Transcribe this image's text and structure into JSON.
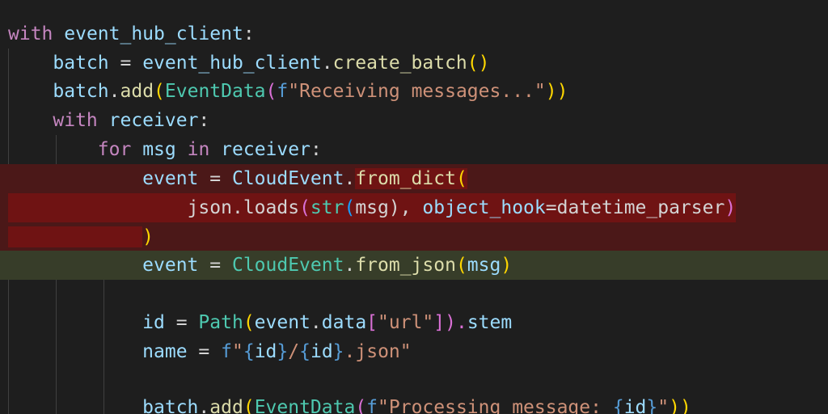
{
  "editor": {
    "lines": [
      {
        "segments": [
          "with",
          " ",
          "event_hub_client",
          ":"
        ]
      },
      {
        "segments": [
          "    ",
          "batch",
          " = ",
          "event_hub_client",
          ".",
          "create_batch",
          "()"
        ]
      },
      {
        "segments": [
          "    ",
          "batch",
          ".",
          "add",
          "(",
          "EventData",
          "(",
          "f",
          "\"Receiving messages...\"",
          "))"
        ]
      },
      {
        "segments": [
          "    ",
          "with",
          " ",
          "receiver",
          ":"
        ]
      },
      {
        "segments": [
          "        ",
          "for",
          " ",
          "msg",
          " ",
          "in",
          " ",
          "receiver",
          ":"
        ]
      },
      {
        "segments": [
          "            ",
          "event",
          " = ",
          "CloudEvent",
          ".",
          "from_dict",
          "("
        ]
      },
      {
        "segments": [
          "                ",
          "json",
          ".",
          "loads",
          "(",
          "str",
          "(",
          "msg",
          "), ",
          "object_hook",
          "=",
          "datetime_parser",
          ")"
        ]
      },
      {
        "segments": [
          "            ",
          ")"
        ]
      },
      {
        "segments": [
          "            ",
          "event",
          " = ",
          "CloudEvent",
          ".",
          "from_json",
          "(",
          "msg",
          ")"
        ]
      },
      {
        "segments": [
          ""
        ]
      },
      {
        "segments": [
          "            ",
          "id",
          " = ",
          "Path",
          "(",
          "event",
          ".",
          "data",
          "[",
          "\"url\"",
          "]).",
          "stem"
        ]
      },
      {
        "segments": [
          "            ",
          "name",
          " = ",
          "f",
          "\"",
          "{",
          "id",
          "}",
          "/",
          "{",
          "id",
          "}",
          ".json\""
        ]
      },
      {
        "segments": [
          ""
        ]
      },
      {
        "segments": [
          "            ",
          "batch",
          ".",
          "add",
          "(",
          "EventData",
          "(",
          "f",
          "\"Processing message: ",
          "{",
          "id",
          "}",
          "\"",
          "))"
        ]
      }
    ]
  },
  "colors": {
    "background": "#1e1e1e",
    "removed_line": "#4b1818",
    "removed_highlight": "#6f1313",
    "added_line": "#373d29",
    "keyword": "#c586c0",
    "variable": "#9cdcfe",
    "function": "#dcdcaa",
    "class": "#4ec9b0",
    "string": "#ce9178",
    "builtin_blue": "#569cd6"
  }
}
